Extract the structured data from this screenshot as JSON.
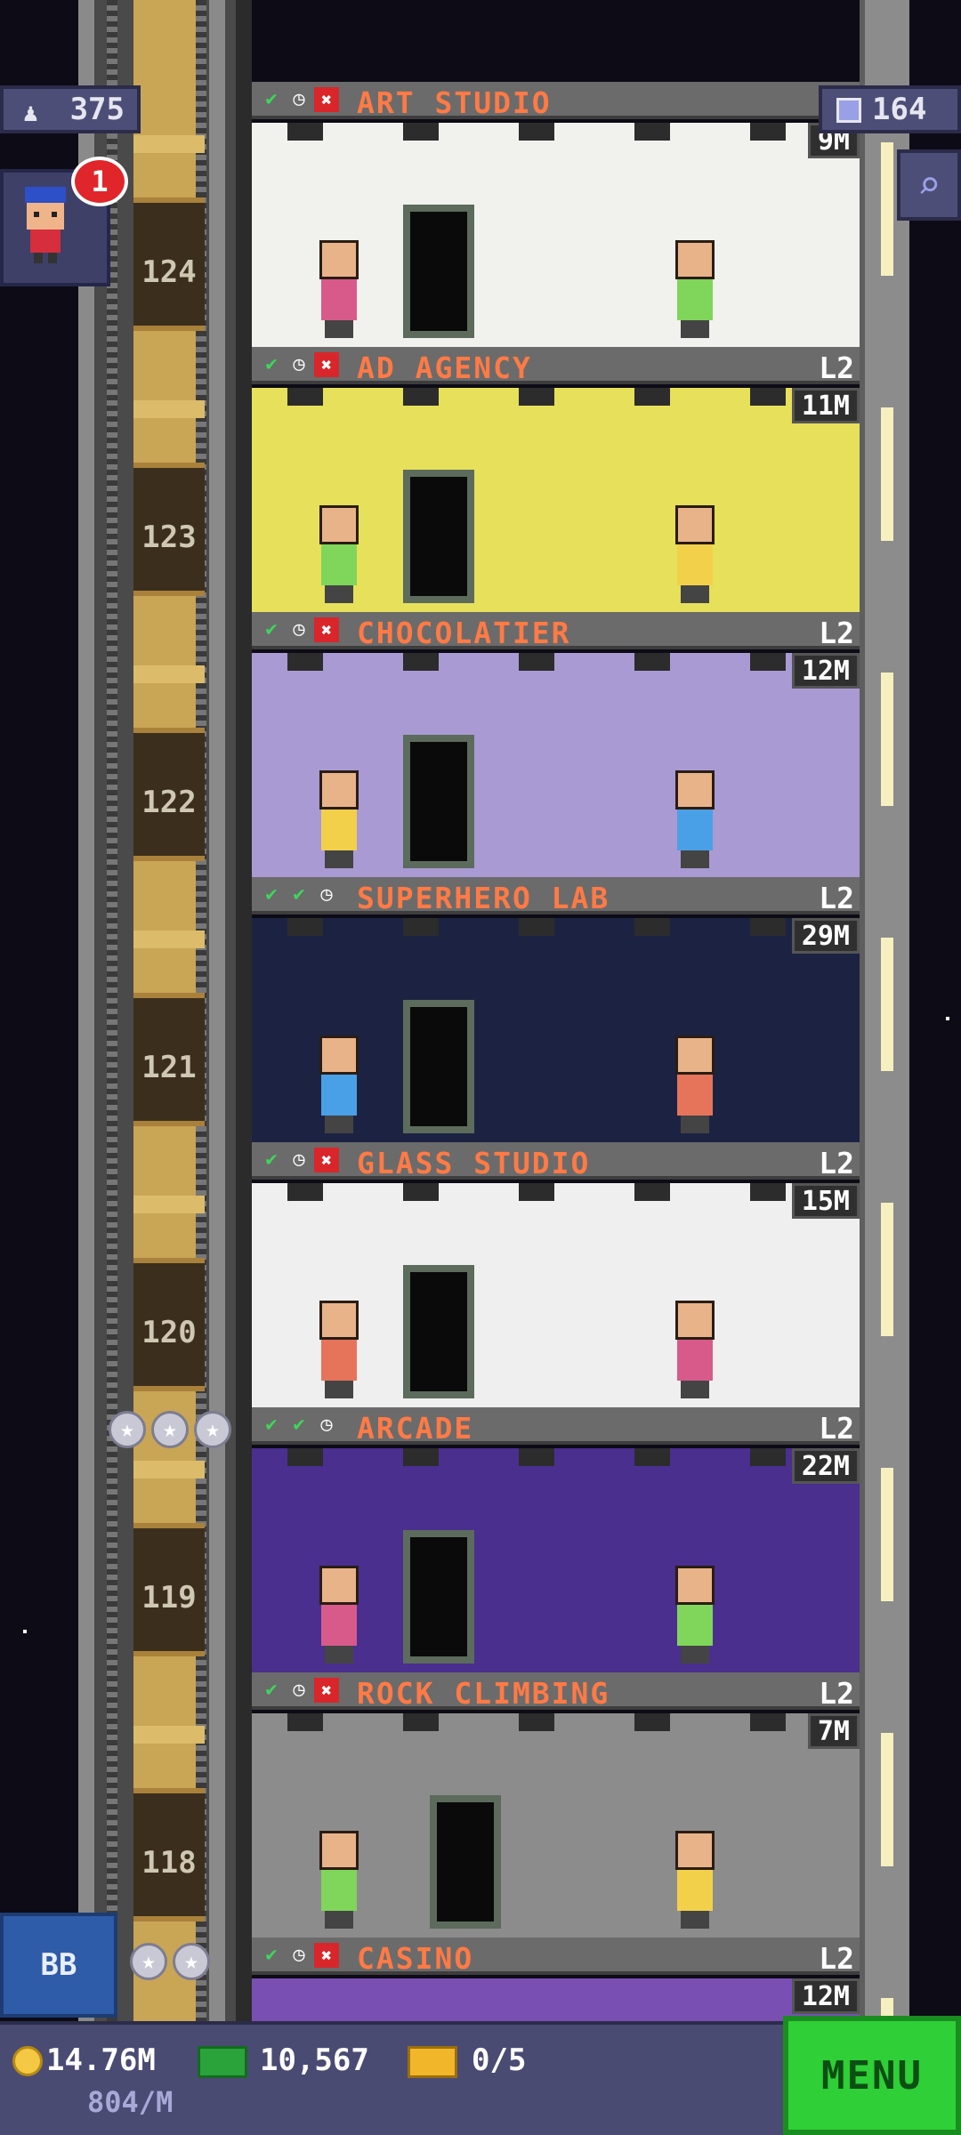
{
  "hud": {
    "population": "375",
    "bux": "164",
    "notification_count": "1",
    "bb_label": "BB"
  },
  "bottom_bar": {
    "coins": "14.76M",
    "coin_rate": "804/M",
    "cash": "10,567",
    "tickets": "0/5",
    "menu_label": "MENU"
  },
  "shaft_floor_numbers": [
    "124",
    "123",
    "122",
    "121",
    "120",
    "119",
    "118"
  ],
  "floors": [
    {
      "name": "ART STUDIO",
      "level": "",
      "pop": "9M",
      "icons": [
        "check",
        "clock",
        "x"
      ],
      "wall": "#f1f1ee"
    },
    {
      "name": "AD AGENCY",
      "level": "L2",
      "pop": "11M",
      "icons": [
        "check",
        "clock",
        "x"
      ],
      "wall": "#e6e05a"
    },
    {
      "name": "CHOCOLATIER",
      "level": "L2",
      "pop": "12M",
      "icons": [
        "check",
        "clock",
        "x"
      ],
      "wall": "#a99ad4"
    },
    {
      "name": "SUPERHERO LAB",
      "level": "L2",
      "pop": "29M",
      "icons": [
        "check",
        "check",
        "clock"
      ],
      "wall": "#1c2342"
    },
    {
      "name": "GLASS STUDIO",
      "level": "L2",
      "pop": "15M",
      "icons": [
        "check",
        "clock",
        "x"
      ],
      "wall": "#efefef"
    },
    {
      "name": "ARCADE",
      "level": "L2",
      "pop": "22M",
      "icons": [
        "check",
        "check",
        "clock"
      ],
      "wall": "#4a2f8e"
    },
    {
      "name": "ROCK CLIMBING",
      "level": "L2",
      "pop": "7M",
      "icons": [
        "check",
        "clock",
        "x"
      ],
      "wall": "#8c8c8c"
    },
    {
      "name": "CASINO",
      "level": "L2",
      "pop": "12M",
      "icons": [
        "check",
        "clock",
        "x"
      ],
      "wall": "#7a4fb4"
    }
  ],
  "icons": {
    "population": "person-icon",
    "bux": "bux-icon",
    "search": "magnifier-icon",
    "coin": "coin-icon",
    "cash": "cash-icon",
    "ticket": "ticket-icon"
  }
}
